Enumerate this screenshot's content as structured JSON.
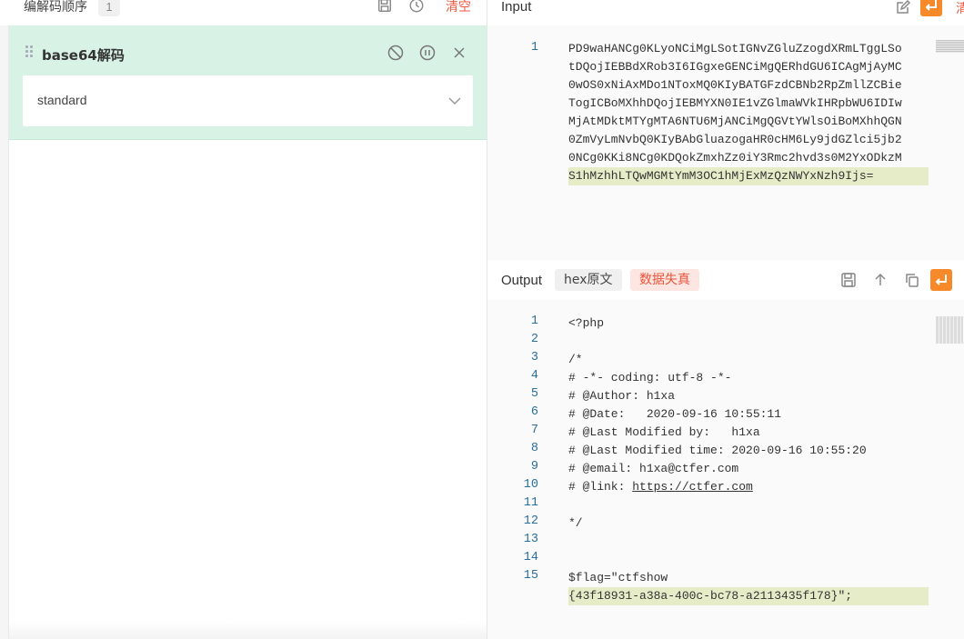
{
  "left_panel": {
    "title": "编解码顺序",
    "count": "1",
    "clear_label": "清空",
    "icons": [
      "save-icon",
      "history-icon"
    ],
    "operation": {
      "title": "base64解码",
      "icons": [
        "disable-icon",
        "pause-icon",
        "close-icon"
      ],
      "select_value": "standard"
    }
  },
  "input_panel": {
    "label": "Input",
    "clear_label_partial": "清",
    "lines": [
      "PD9waHANCg0KLyoNCiMgLSotIGNvZGluZzogdXRmLTggLSo",
      "tDQojIEBBdXRob3I6IGgxeGENCiMgQERhdGU6ICAgMjAyMC",
      "0wOS0xNiAxMDo1NToxMQ0KIyBATGFzdCBNb2RpZmllZCBie",
      "TogICBoMXhhDQojIEBMYXN0IE1vZGlmaWVkIHRpbWU6IDIw",
      "MjAtMDktMTYgMTA6NTU6MjANCiMgQGVtYWlsOiBoMXhhQGN",
      "0ZmVyLmNvbQ0KIyBAbGluazogaHR0cHM6Ly9jdGZlci5jb2",
      "0NCg0KKi8NCg0KDQokZmxhZz0iY3Rmc2hvd3s0M2YxODkzM",
      "S1hMzhhLTQwMGMtYmM3OC1hMjExMzQzNWYxNzh9Ijs="
    ],
    "line_number": "1"
  },
  "output_panel": {
    "label": "Output",
    "tag_hex": "hex原文",
    "tag_warning": "数据失真",
    "lines": [
      {
        "n": "1",
        "text": "<?php"
      },
      {
        "n": "2",
        "text": ""
      },
      {
        "n": "3",
        "text": "/*"
      },
      {
        "n": "4",
        "text": "# -*- coding: utf-8 -*-"
      },
      {
        "n": "5",
        "text": "# @Author: h1xa"
      },
      {
        "n": "6",
        "text": "# @Date:   2020-09-16 10:55:11"
      },
      {
        "n": "7",
        "text": "# @Last Modified by:   h1xa"
      },
      {
        "n": "8",
        "text": "# @Last Modified time: 2020-09-16 10:55:20"
      },
      {
        "n": "9",
        "text": "# @email: h1xa@ctfer.com"
      },
      {
        "n": "10",
        "text": "# @link: https://ctfer.com"
      },
      {
        "n": "11",
        "text": ""
      },
      {
        "n": "12",
        "text": "*/"
      },
      {
        "n": "13",
        "text": ""
      },
      {
        "n": "14",
        "text": ""
      },
      {
        "n": "15",
        "text": "$flag=\"ctfshow"
      }
    ],
    "wrap_line": "{43f18931-a38a-400c-bc78-a2113435f178}\";",
    "link_url": "https://ctfer.com",
    "icons": [
      "save-icon",
      "upload-icon",
      "copy-icon",
      "wrap-icon"
    ]
  },
  "colors": {
    "accent": "#f6892a",
    "clear_red": "#f25a40",
    "card_green": "#d9f2e6",
    "line_highlight": "#e7ecc8",
    "line_number": "#2a6f9e"
  }
}
